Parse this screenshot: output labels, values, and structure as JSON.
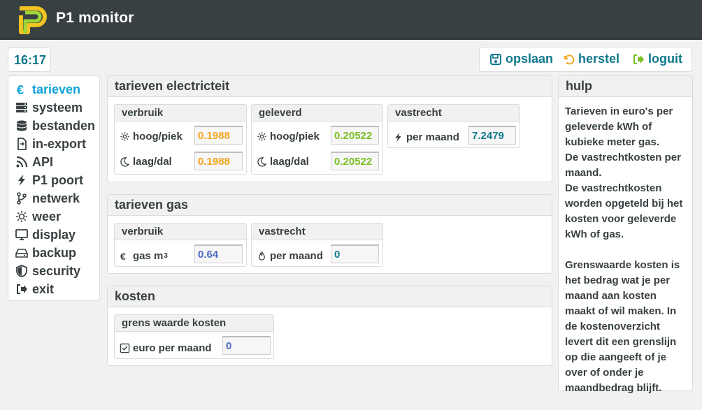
{
  "app": {
    "title": "P1 monitor"
  },
  "clock": "16:17",
  "actions": {
    "save": "opslaan",
    "reset": "herstel",
    "logout": "loguit"
  },
  "menu": [
    {
      "label": "tarieven",
      "icon": "euro-icon",
      "active": true
    },
    {
      "label": "systeem",
      "icon": "server-icon"
    },
    {
      "label": "bestanden",
      "icon": "database-icon"
    },
    {
      "label": "in-export",
      "icon": "file-export-icon"
    },
    {
      "label": "API",
      "icon": "rss-icon"
    },
    {
      "label": "P1 poort",
      "icon": "bolt-icon"
    },
    {
      "label": "netwerk",
      "icon": "network-icon"
    },
    {
      "label": "weer",
      "icon": "weather-icon"
    },
    {
      "label": "display",
      "icon": "monitor-icon"
    },
    {
      "label": "backup",
      "icon": "drive-icon"
    },
    {
      "label": "security",
      "icon": "shield-icon"
    },
    {
      "label": "exit",
      "icon": "exit-icon"
    }
  ],
  "electricity": {
    "title": "tarieven electricteit",
    "consumption": {
      "title": "verbruik",
      "high_label": "hoog/piek",
      "high_value": "0.1988",
      "low_label": "laag/dal",
      "low_value": "0.1988"
    },
    "delivered": {
      "title": "geleverd",
      "high_label": "hoog/piek",
      "high_value": "0.20522",
      "low_label": "laag/dal",
      "low_value": "0.20522"
    },
    "fixed": {
      "title": "vastrecht",
      "label": "per maand",
      "value": "7.2479"
    }
  },
  "gas": {
    "title": "tarieven gas",
    "consumption": {
      "title": "verbruik",
      "label": "gas m",
      "unit_sup": "3",
      "value": "0.64"
    },
    "fixed": {
      "title": "vastrecht",
      "label": "per maand",
      "value": "0"
    }
  },
  "costs": {
    "title": "kosten",
    "limit": {
      "title": "grens waarde kosten",
      "label": "euro per maand",
      "value": "0"
    }
  },
  "help": {
    "title": "hulp",
    "text": "Tarieven in euro's per geleverde kWh of kubieke meter gas.\nDe vastrechtkosten per maand.\nDe vastrechtkosten worden opgeteld bij het kosten voor geleverde kWh of gas.\n\nGrenswaarde kosten is het bedrag wat je per maand aan kosten maakt of wil maken. In de kostenoverzicht levert dit een grenslijn op die aangeeft of je over of onder je maandbedrag blijft."
  },
  "colors": {
    "topbar": "#384042",
    "accent": "#0ea3d9",
    "action": "#10788d",
    "orange": "#f3a61f",
    "green": "#7bbf25",
    "logo_yellow": "#f3c31f",
    "logo_green": "#9dd53a"
  }
}
